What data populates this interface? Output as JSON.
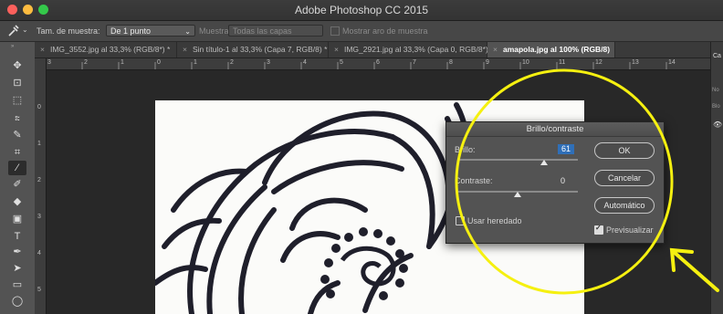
{
  "window": {
    "title": "Adobe Photoshop CC 2015"
  },
  "colors": {
    "close": "#fc605c",
    "minimize": "#fdbc40",
    "zoom": "#34c84a",
    "highlight": "#f5f010"
  },
  "options_bar": {
    "tool_icon": "eyedropper-icon",
    "sample_size_label": "Tam. de muestra:",
    "sample_size_value": "De 1 punto",
    "sample_label": "Muestra:",
    "sample_value": "Todas las capas",
    "ring_label": "Mostrar aro de muestra"
  },
  "tabs": [
    {
      "label": "IMG_3552.jpg al 33,3% (RGB/8*) *",
      "active": false
    },
    {
      "label": "Sin título-1 al 33,3% (Capa 7, RGB/8) *",
      "active": false
    },
    {
      "label": "IMG_2921.jpg al 33,3% (Capa 0, RGB/8*) *",
      "active": false
    },
    {
      "label": "amapola.jpg al 100% (RGB/8)",
      "active": true
    }
  ],
  "ruler": {
    "h": [
      "3",
      "2",
      "1",
      "0",
      "1",
      "2",
      "3",
      "4",
      "5",
      "6",
      "7",
      "8",
      "9",
      "10",
      "11",
      "12",
      "13",
      "14"
    ],
    "v": [
      "0",
      "1",
      "2",
      "3",
      "4",
      "5"
    ]
  },
  "right_panel": {
    "top_label": "Ca",
    "labels": [
      "No",
      "Blo"
    ]
  },
  "dialog": {
    "title": "Brillo/contraste",
    "brightness_label": "Brillo:",
    "brightness_value": "61",
    "brightness_fraction": 0.72,
    "contrast_label": "Contraste:",
    "contrast_value": "0",
    "contrast_fraction": 0.5,
    "ok_label": "OK",
    "cancel_label": "Cancelar",
    "auto_label": "Automático",
    "legacy_label": "Usar heredado",
    "legacy_checked": false,
    "preview_label": "Previsualizar",
    "preview_checked": true
  }
}
